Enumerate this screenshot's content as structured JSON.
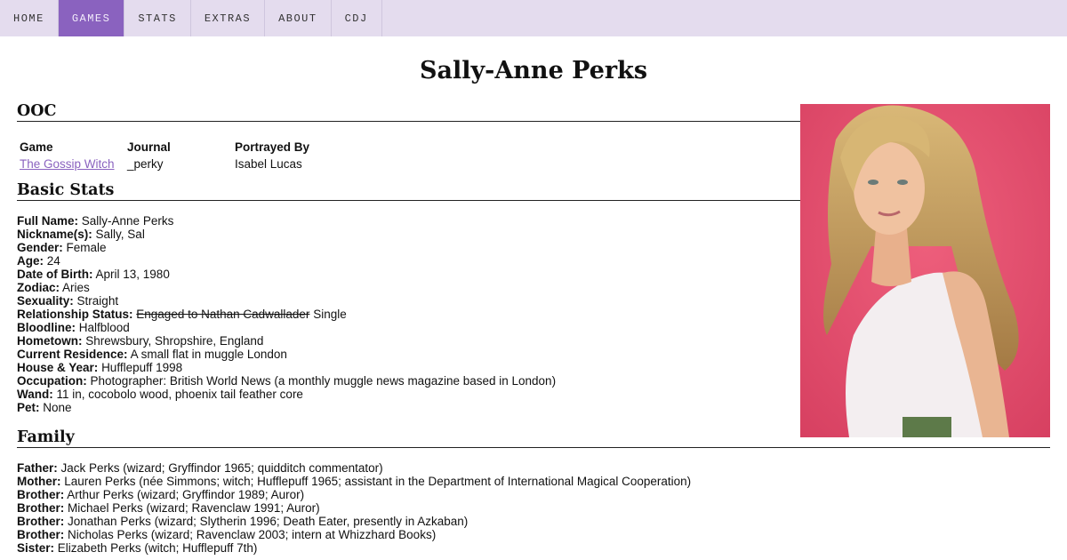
{
  "nav": {
    "items": [
      {
        "label": "HOME"
      },
      {
        "label": "GAMES"
      },
      {
        "label": "STATS"
      },
      {
        "label": "EXTRAS"
      },
      {
        "label": "ABOUT"
      },
      {
        "label": "CDJ"
      }
    ],
    "active": "GAMES"
  },
  "page_title": "Sally-Anne Perks",
  "ooc": {
    "heading": "OOC",
    "headers": [
      "Game",
      "Journal",
      "Portrayed By"
    ],
    "row": {
      "game": "The Gossip Witch",
      "journal": "_perky",
      "portrayed_by": "Isabel Lucas"
    }
  },
  "basic_stats": {
    "heading": "Basic Stats",
    "items": [
      {
        "label": "Full Name:",
        "value": "Sally-Anne Perks"
      },
      {
        "label": "Nickname(s):",
        "value": "Sally, Sal"
      },
      {
        "label": "Gender:",
        "value": "Female"
      },
      {
        "label": "Age:",
        "value": "24"
      },
      {
        "label": "Date of Birth:",
        "value": "April 13, 1980"
      },
      {
        "label": "Zodiac:",
        "value": "Aries"
      },
      {
        "label": "Sexuality:",
        "value": "Straight"
      },
      {
        "label": "Relationship Status:",
        "struck": "Engaged to Nathan Cadwallader",
        "value": "Single"
      },
      {
        "label": "Bloodline:",
        "value": "Halfblood"
      },
      {
        "label": "Hometown:",
        "value": "Shrewsbury, Shropshire, England"
      },
      {
        "label": "Current Residence:",
        "value": "A small flat in muggle London"
      },
      {
        "label": "House & Year:",
        "value": "Hufflepuff 1998"
      },
      {
        "label": "Occupation:",
        "value": "Photographer: British World News (a monthly muggle news magazine based in London)"
      },
      {
        "label": "Wand:",
        "value": "11 in, cocobolo wood, phoenix tail feather core"
      },
      {
        "label": "Pet:",
        "value": "None"
      }
    ]
  },
  "family": {
    "heading": "Family",
    "items": [
      {
        "label": "Father:",
        "value": "Jack Perks (wizard; Gryffindor 1965; quidditch commentator)"
      },
      {
        "label": "Mother:",
        "value": "Lauren Perks (née Simmons; witch; Hufflepuff 1965; assistant in the Department of International Magical Cooperation)"
      },
      {
        "label": "Brother:",
        "value": "Arthur Perks (wizard; Gryffindor 1989; Auror)"
      },
      {
        "label": "Brother:",
        "value": "Michael Perks (wizard; Ravenclaw 1991; Auror)"
      },
      {
        "label": "Brother:",
        "value": "Jonathan Perks (wizard; Slytherin 1996; Death Eater, presently in Azkaban)"
      },
      {
        "label": "Brother:",
        "value": "Nicholas Perks (wizard; Ravenclaw 2003; intern at Whizzhard Books)"
      },
      {
        "label": "Sister:",
        "value": "Elizabeth Perks (witch; Hufflepuff 7th)"
      }
    ]
  },
  "colors": {
    "nav_bg": "#e4dcee",
    "nav_active": "#8a62bf",
    "link": "#8a62bf",
    "photo_bg": "#e6506f"
  },
  "portrait_icon": "portrait-photo"
}
